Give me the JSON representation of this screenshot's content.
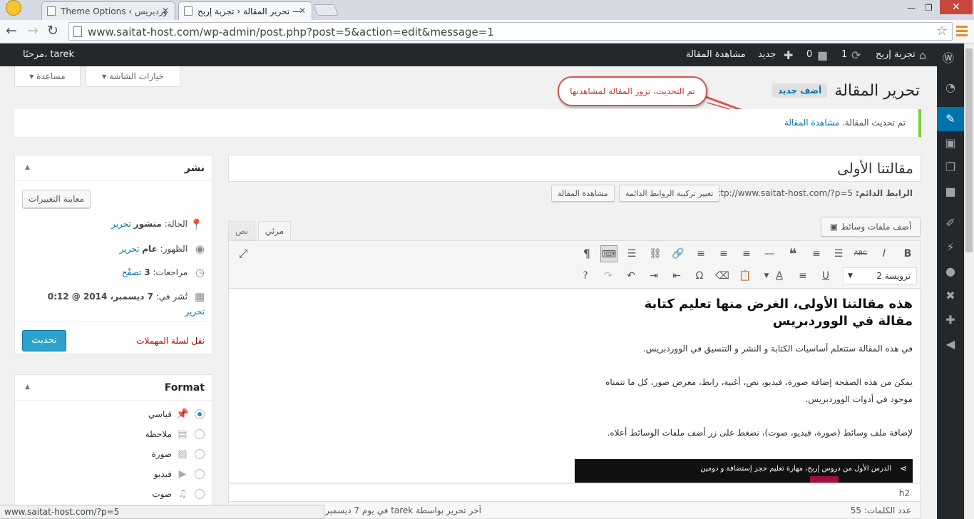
{
  "browser": {
    "tabs": [
      {
        "label": "Theme Options ‹ وردبريس"
      },
      {
        "label": "تحرير المقالة ‹ تجربة إربح —"
      }
    ],
    "url": "www.saitat-host.com/wp-admin/post.php?post=5&action=edit&message=1",
    "status_url": "www.saitat-host.com/?p=5"
  },
  "adminbar": {
    "site_name": "تجربة إربح",
    "updates_count": "1",
    "comments_count": "0",
    "new_label": "جديد",
    "view_post": "مشاهدة المقالة",
    "greeting": "مرحبًا، tarek"
  },
  "screen": {
    "options_label": "خيارات الشاشة",
    "help_label": "مساعدة"
  },
  "page": {
    "title": "تحرير المقالة",
    "add_new": "أضف جديد"
  },
  "callout": {
    "text": "تم التحديث، تزور المقالة لمشاهدتها"
  },
  "notice": {
    "text": "تم تحديث المقالة.",
    "link": "مشاهدة المقالة"
  },
  "post": {
    "title": "مقالتنا الأولى",
    "permalink_label": "الرابط الدائم:",
    "permalink_url": "http://www.saitat-host.com/?p=5",
    "change_permalinks": "تغيير تركيبة الروابط الدائمة",
    "view_post": "مشاهدة المقالة"
  },
  "publish": {
    "title": "نشر",
    "preview_changes": "معاينة التغييرات",
    "status_label": "الحالة:",
    "status_value": "منشور",
    "visibility_label": "الظهور:",
    "visibility_value": "عام",
    "revisions_label": "مراجعات:",
    "revisions_value": "3",
    "browse": "تصفّح",
    "edit": "تحرير",
    "published_label": "تُشر في:",
    "published_value": "7 ديسمبر، 2014 @ 0:12",
    "trash": "نقل لسلة المهملات",
    "update": "تحديث"
  },
  "format": {
    "title": "Format",
    "options": [
      {
        "label": "قياسي",
        "icon": "pin-icon",
        "checked": true
      },
      {
        "label": "ملاحظة",
        "icon": "note-icon",
        "checked": false
      },
      {
        "label": "صورة",
        "icon": "image-icon",
        "checked": false
      },
      {
        "label": "فيديو",
        "icon": "video-icon",
        "checked": false
      },
      {
        "label": "صوت",
        "icon": "audio-icon",
        "checked": false
      }
    ]
  },
  "editor": {
    "add_media": "أضف ملفات وسائط",
    "tab_visual": "مرئي",
    "tab_text": "نص",
    "format_select": "ترويسة 2",
    "heading": "هذه مقالتنا الأولى، الغرض منها تعليم كتابة مقالة في الووردبريس",
    "paragraphs": [
      "في هذه المقالة ستتعلم أساسيات الكتابة و النشر و التنسيق في الووردبريس.",
      "يمكن من هذه الصفحة إضافة صورة، فيديو، نص، أغنية، رابط، معرض صور، كل ما تتمناه",
      "موجود في أدوات الووردبريس.",
      "لإضافة ملف وسائط (صورة، فيديو، صوت)، نضغط على زر أضف ملفات الوسائط أعلاه."
    ],
    "video_title": "الدرس الأول من دروس إربح، مهارة تعليم حجز إستضافة و دومين",
    "path": "h2",
    "word_count": "عدد الكلمات: 55",
    "last_edited": "آخر تحرير بواسطة tarek في يوم 7 ديسمبر"
  }
}
